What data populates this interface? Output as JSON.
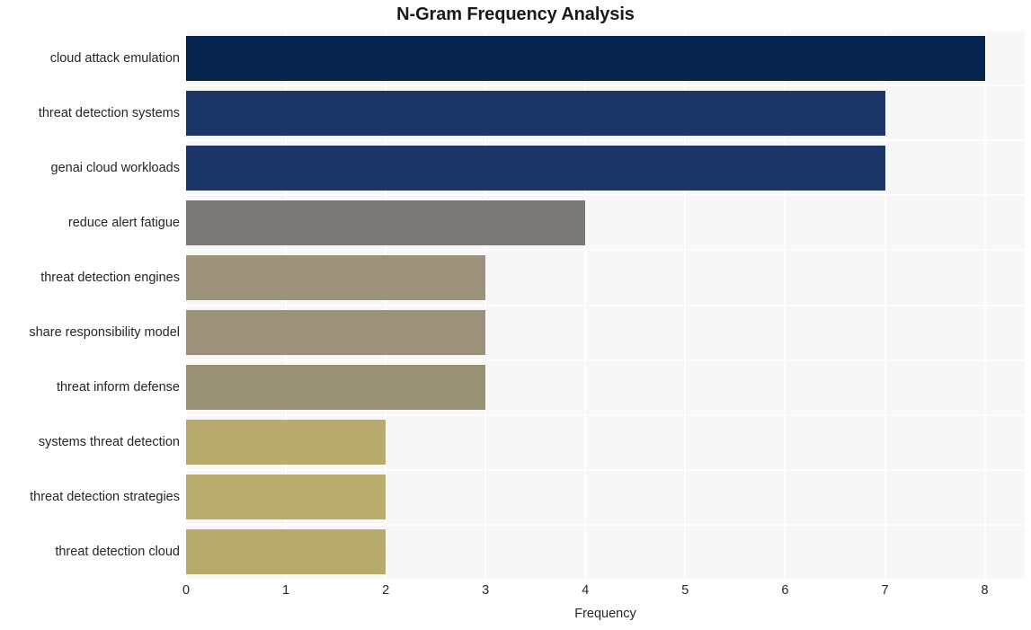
{
  "chart_data": {
    "type": "bar",
    "orientation": "horizontal",
    "title": "N-Gram Frequency Analysis",
    "xlabel": "Frequency",
    "ylabel": "",
    "xlim": [
      0,
      8.4
    ],
    "x_ticks": [
      "0",
      "1",
      "2",
      "3",
      "4",
      "5",
      "6",
      "7",
      "8"
    ],
    "x_tick_values": [
      0,
      1,
      2,
      3,
      4,
      5,
      6,
      7,
      8
    ],
    "grid": true,
    "legend": "none",
    "categories": [
      "cloud attack emulation",
      "threat detection systems",
      "genai cloud workloads",
      "reduce alert fatigue",
      "threat detection engines",
      "share responsibility model",
      "threat inform defense",
      "systems threat detection",
      "threat detection strategies",
      "threat detection cloud"
    ],
    "values": [
      8,
      7,
      7,
      4,
      3,
      3,
      3,
      2,
      2,
      2
    ],
    "bar_colors": [
      "#05224c",
      "#1c3668",
      "#1c3668",
      "#7b7975",
      "#9c937a",
      "#9c9279",
      "#999174",
      "#b9ab6e",
      "#bbad6e",
      "#b8aa6c"
    ],
    "plot_background": "#f7f7f8",
    "grid_color": "#ffffff",
    "text_color": "#262626",
    "title_color": "#1a1a1a",
    "page_background": "#ffffff"
  }
}
